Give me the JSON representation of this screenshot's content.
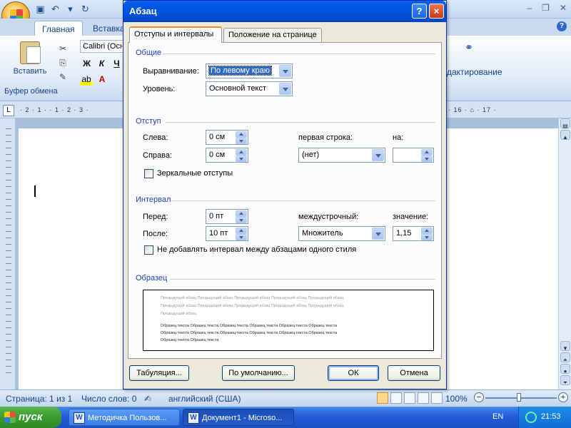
{
  "word": {
    "tabs": [
      "Главная",
      "Вставка"
    ],
    "paste_label": "Вставить",
    "clipboard_group": "Буфер обмена",
    "font_name": "Calibri (Осн",
    "bold": "Ж",
    "italic": "К",
    "underline": "Ч",
    "editing_label": "дактирование",
    "ruler_left": "· 2 · 1 · · 1 · 2 · 3 ·",
    "ruler_right": "· 16 · ⌂ · 17 ·"
  },
  "dialog": {
    "title": "Абзац",
    "help_btn": "?",
    "close_btn": "×",
    "tabs": {
      "indents": "Отступы и интервалы",
      "position": "Положение на странице"
    },
    "general": {
      "title": "Общие",
      "alignment_label": "Выравнивание:",
      "alignment_value": "По левому краю",
      "level_label": "Уровень:",
      "level_value": "Основной текст"
    },
    "indent": {
      "title": "Отступ",
      "left_label": "Слева:",
      "left_value": "0 см",
      "right_label": "Справа:",
      "right_value": "0 см",
      "first_line_label": "первая строка:",
      "first_line_value": "(нет)",
      "by_label": "на:",
      "by_value": "",
      "mirror_label": "Зеркальные отступы"
    },
    "spacing": {
      "title": "Интервал",
      "before_label": "Перед:",
      "before_value": "0 пт",
      "after_label": "После:",
      "after_value": "10 пт",
      "line_label": "междустрочный:",
      "line_value": "Множитель",
      "at_label": "значение:",
      "at_value": "1,15",
      "no_space_label": "Не добавлять интервал между абзацами одного стиля"
    },
    "sample": {
      "title": "Образец",
      "prev_line1": "Предыдущий абзац Предыдущий абзац Предыдущий абзац Предыдущий абзац Предыдущий абзац",
      "prev_line2": "Предыдущий абзац Предыдущий абзац Предыдущий абзац Предыдущий абзац Предыдущий абзац",
      "prev_line3": "Предыдущий абзац",
      "text_line1": "Образец текста Образец текста Образец текста Образец текста Образец текста Образец текста",
      "text_line2": "Образец текста Образец текста Образец текста Образец текста Образец текста Образец текста",
      "text_line3": "Образец текста Образец текста"
    },
    "buttons": {
      "tabs": "Табуляция...",
      "default": "По умолчанию...",
      "ok": "ОК",
      "cancel": "Отмена"
    }
  },
  "status": {
    "page": "Страница: 1 из 1",
    "words": "Число слов: 0",
    "language": "английский (США)",
    "zoom": "100%"
  },
  "taskbar": {
    "start": "пуск",
    "items": [
      "Методичка Пользов...",
      "Документ1 - Microso..."
    ],
    "lang": "EN",
    "clock": "21:53"
  }
}
